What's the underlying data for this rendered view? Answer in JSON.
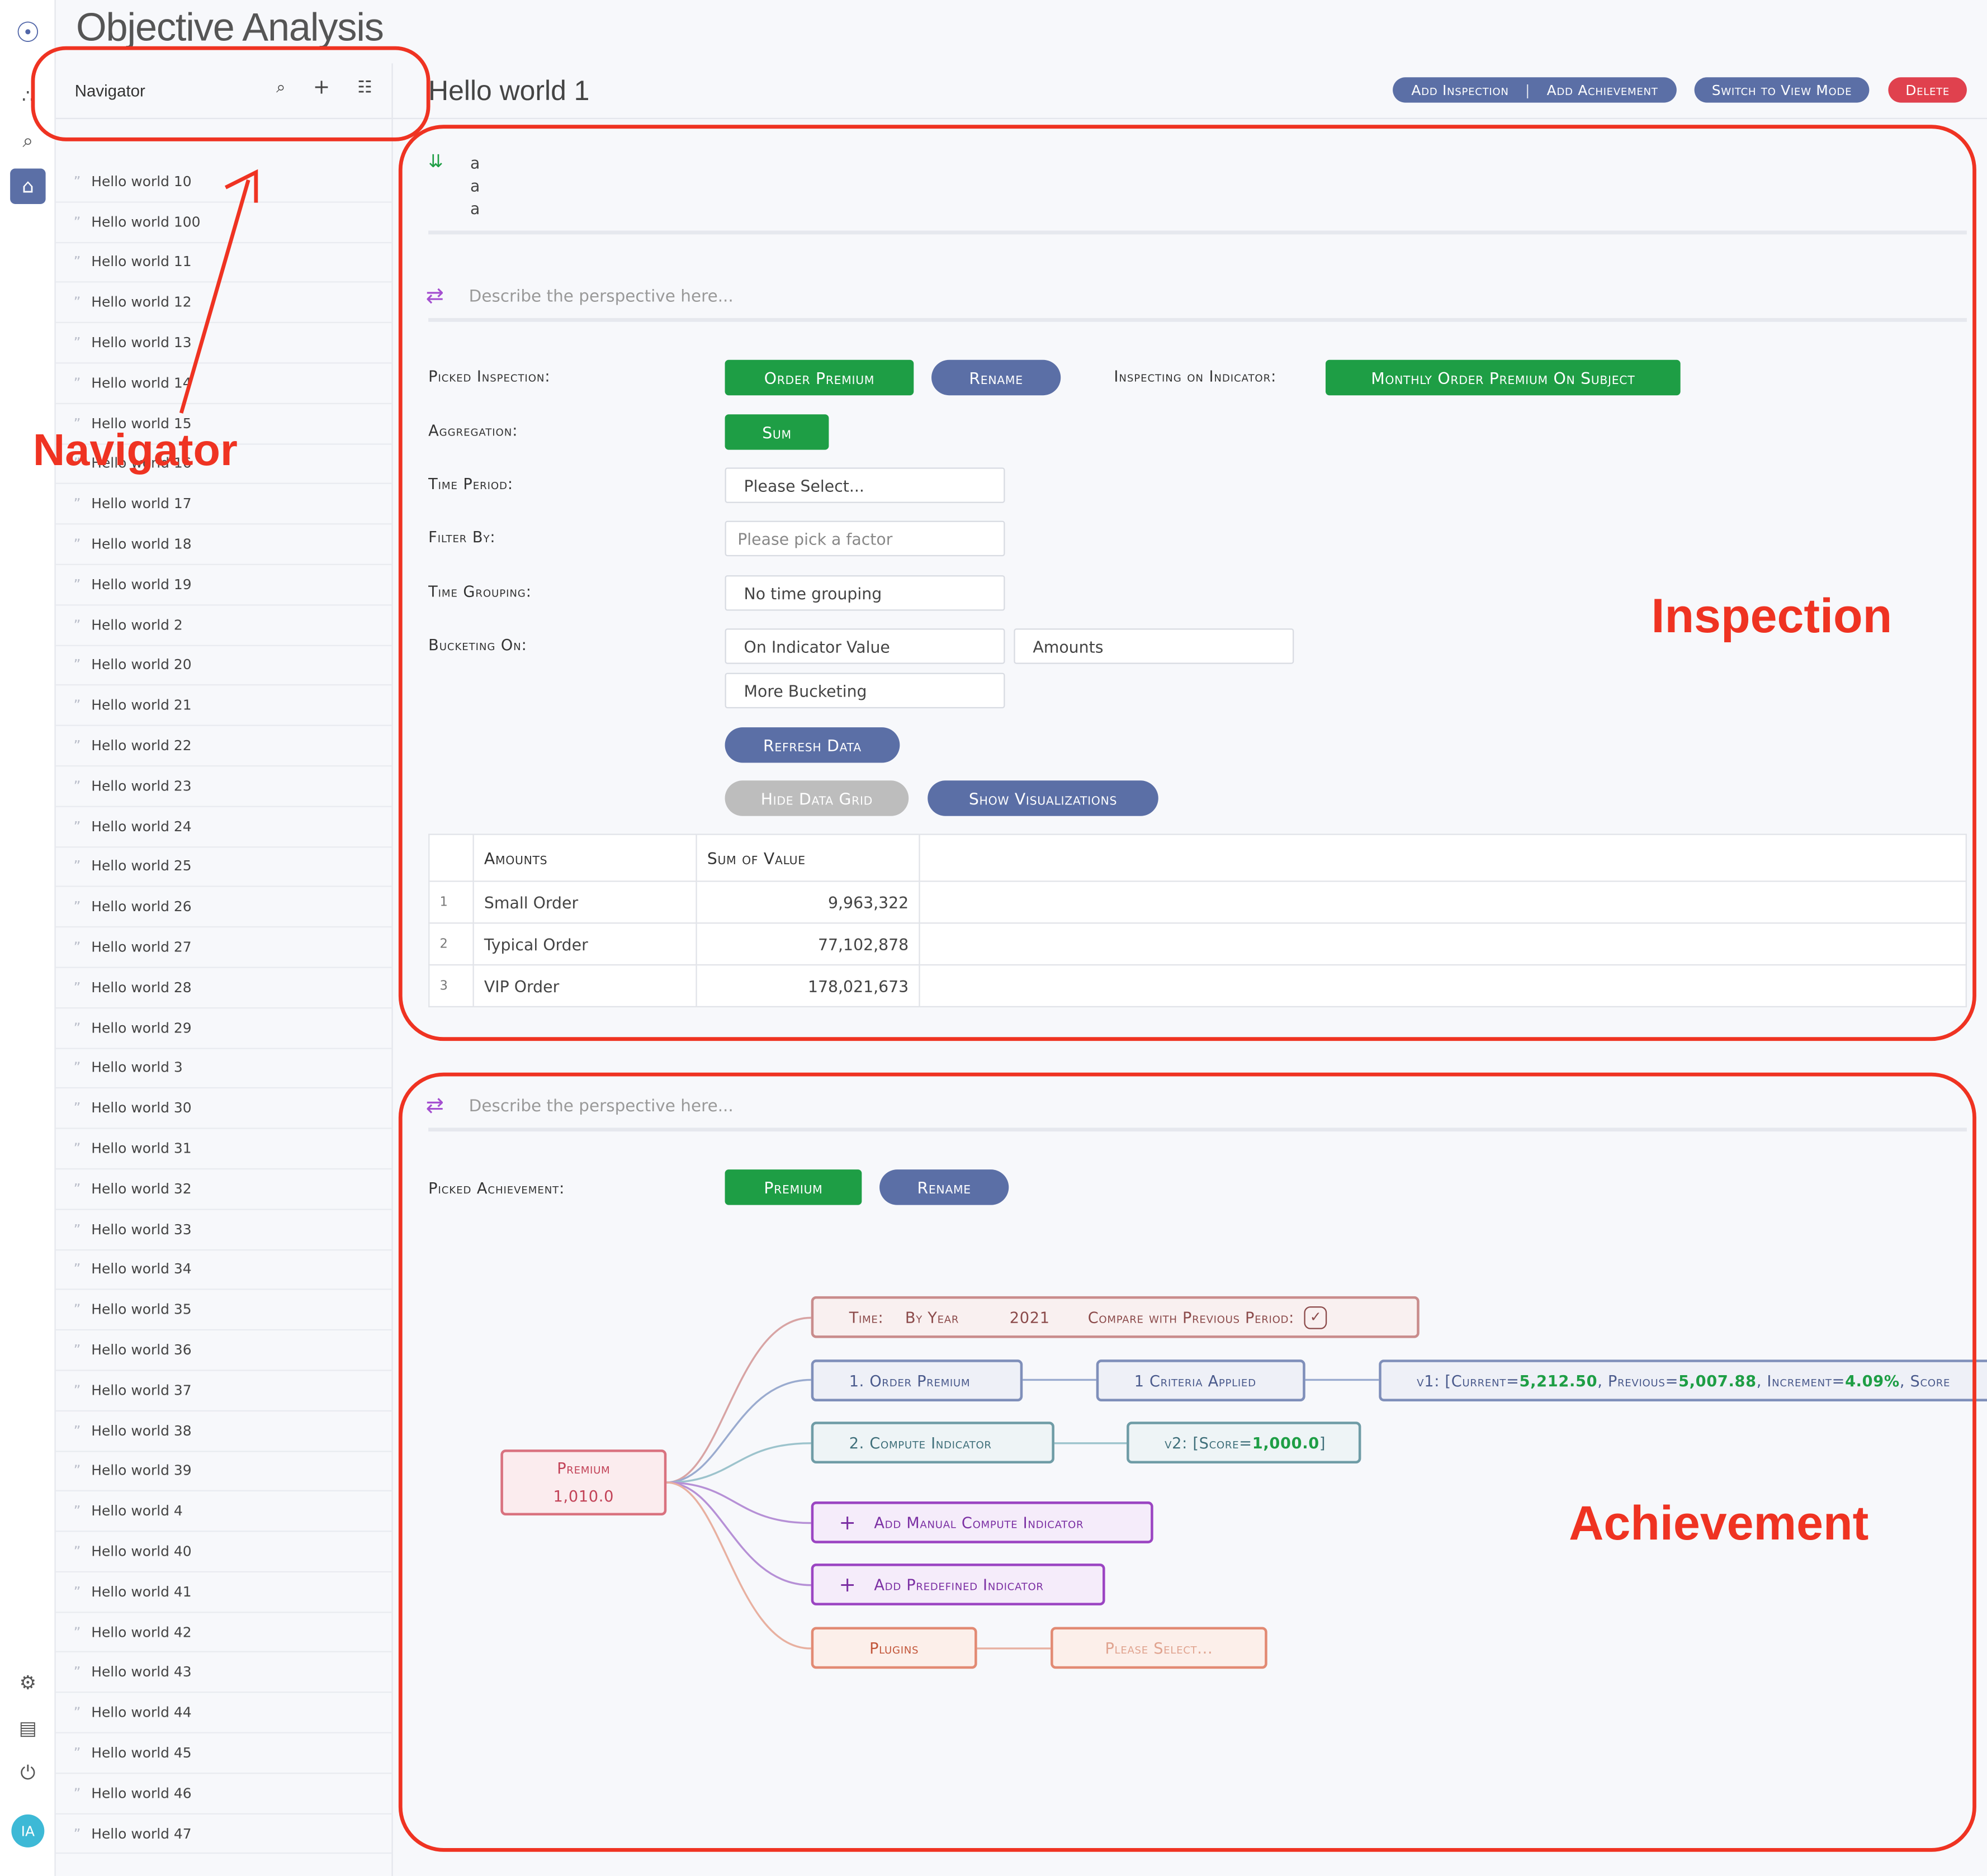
{
  "app": {
    "title": "Objective Analysis"
  },
  "rail": {
    "items": [
      "logo-icon",
      "connected-space-icon",
      "search-icon",
      "objective-analysis-icon",
      "settings-icon",
      "console-icon",
      "logout-icon"
    ],
    "avatar": "IA"
  },
  "navigator": {
    "title": "Navigator",
    "items": [
      "Hello world 10",
      "Hello world 100",
      "Hello world 11",
      "Hello world 12",
      "Hello world 13",
      "Hello world 14",
      "Hello world 15",
      "Hello world 16",
      "Hello world 17",
      "Hello world 18",
      "Hello world 19",
      "Hello world 2",
      "Hello world 20",
      "Hello world 21",
      "Hello world 22",
      "Hello world 23",
      "Hello world 24",
      "Hello world 25",
      "Hello world 26",
      "Hello world 27",
      "Hello world 28",
      "Hello world 29",
      "Hello world 3",
      "Hello world 30",
      "Hello world 31",
      "Hello world 32",
      "Hello world 33",
      "Hello world 34",
      "Hello world 35",
      "Hello world 36",
      "Hello world 37",
      "Hello world 38",
      "Hello world 39",
      "Hello world 4",
      "Hello world 40",
      "Hello world 41",
      "Hello world 42",
      "Hello world 43",
      "Hello world 44",
      "Hello world 45",
      "Hello world 46",
      "Hello world 47"
    ]
  },
  "header": {
    "page_title": "Hello world 1",
    "add_inspection": "Add Inspection",
    "add_achievement": "Add Achievement",
    "switch_mode": "Switch to View Mode",
    "delete": "Delete"
  },
  "description": {
    "lines": [
      "a",
      "a",
      "a"
    ]
  },
  "inspection": {
    "perspective_placeholder": "Describe the perspective here...",
    "picked_label": "Picked Inspection:",
    "picked_value": "Order Premium",
    "rename": "Rename",
    "indicator_label": "Inspecting on Indicator:",
    "indicator_value": "Monthly Order Premium On Subject",
    "aggregation_label": "Aggregation:",
    "aggregation_value": "Sum",
    "time_period_label": "Time Period:",
    "time_period_value": "Please Select...",
    "filter_label": "Filter By:",
    "filter_placeholder": "Please pick a factor",
    "time_grouping_label": "Time Grouping:",
    "time_grouping_value": "No time grouping",
    "bucketing_label": "Bucketing On:",
    "bucketing_value": "On Indicator Value",
    "bucketing_second": "Amounts",
    "more_bucketing": "More Bucketing",
    "refresh": "Refresh Data",
    "hide_grid": "Hide Data Grid",
    "show_viz": "Show Visualizations",
    "grid": {
      "headers": [
        "Amounts",
        "Sum of Value"
      ],
      "rows": [
        {
          "idx": "1",
          "name": "Small Order",
          "value": "9,963,322"
        },
        {
          "idx": "2",
          "name": "Typical Order",
          "value": "77,102,878"
        },
        {
          "idx": "3",
          "name": "VIP Order",
          "value": "178,021,673"
        }
      ]
    }
  },
  "achievement": {
    "perspective_placeholder": "Describe the perspective here...",
    "picked_label": "Picked Achievement:",
    "picked_value": "Premium",
    "rename": "Rename",
    "root": {
      "name": "Premium",
      "value": "1,010.0"
    },
    "time": {
      "label": "Time:",
      "grouping": "By Year",
      "year": "2021",
      "compare": "Compare with Previous Period:"
    },
    "indicator1": {
      "name": "1.  Order Premium",
      "criteria": "1 Criteria Applied",
      "v_prefix": "v1:  [Current=",
      "current": "5,212.50",
      "prev_label": ",  Previous=",
      "previous": "5,007.88",
      "inc_label": ",  Increment=",
      "increment": "4.09%",
      "score_label": ",  Score"
    },
    "indicator2": {
      "name": "2.  Compute Indicator",
      "v_prefix": "v2:  [Score=",
      "score": "1,000.0",
      "v_suffix": "]"
    },
    "add_manual": "Add Manual Compute Indicator",
    "add_predefined": "Add Predefined Indicator",
    "plugins": "Plugins",
    "plugins_placeholder": "Please Select..."
  },
  "annotations": {
    "navigator": "Navigator",
    "inspection": "Inspection",
    "achievement": "Achievement",
    "color": "#ef3322"
  },
  "colors": {
    "accent": "#5b6fa6",
    "primary_green": "#1e9e45",
    "danger": "#e0414e"
  }
}
